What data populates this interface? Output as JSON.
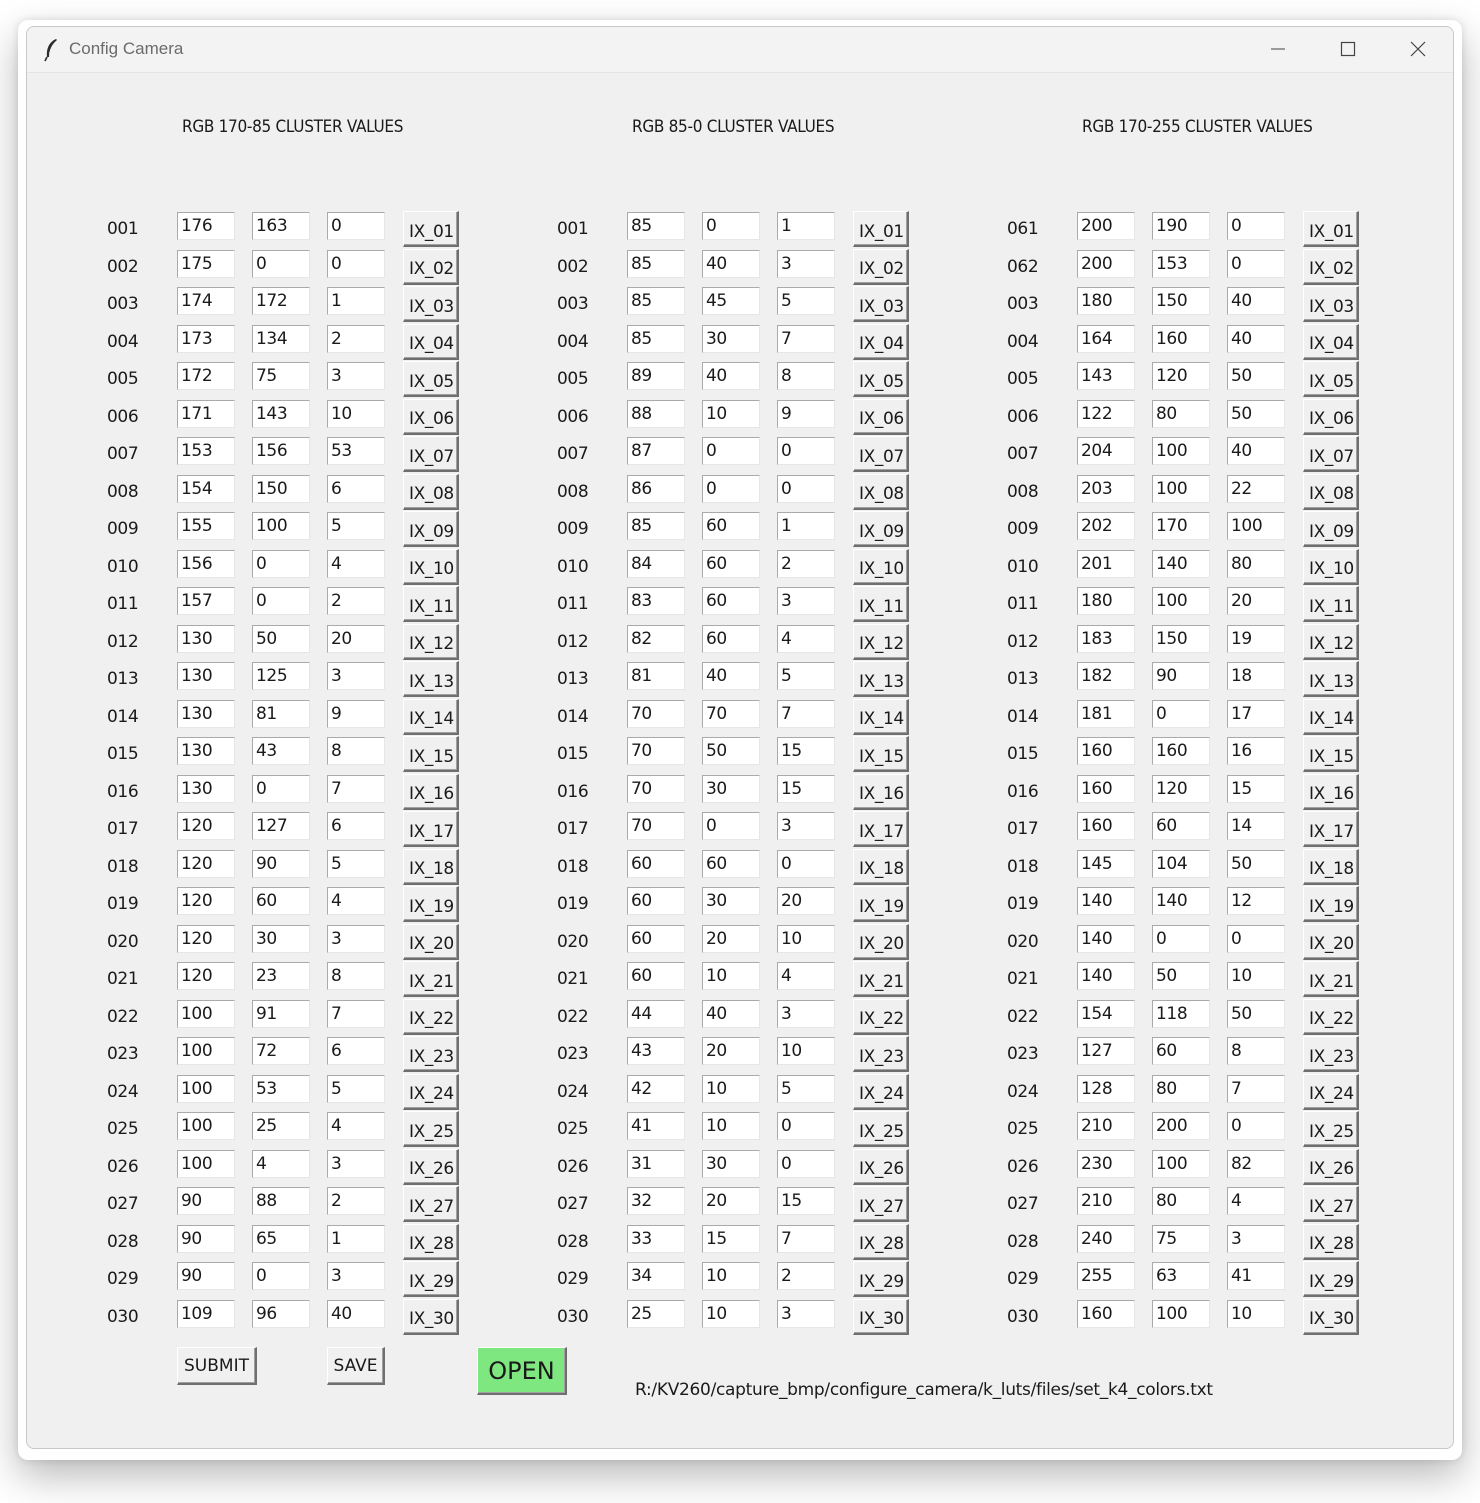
{
  "window": {
    "title": "Config Camera",
    "icon": "feather-icon",
    "controls": [
      "minimize-icon",
      "maximize-icon",
      "close-icon"
    ]
  },
  "columns": [
    {
      "title": "RGB 170-85 CLUSTER VALUES",
      "rows": [
        {
          "label": "001",
          "r": "176",
          "g": "163",
          "b": "0",
          "button": "IX_01"
        },
        {
          "label": "002",
          "r": "175",
          "g": "0",
          "b": "0",
          "button": "IX_02"
        },
        {
          "label": "003",
          "r": "174",
          "g": "172",
          "b": "1",
          "button": "IX_03"
        },
        {
          "label": "004",
          "r": "173",
          "g": "134",
          "b": "2",
          "button": "IX_04"
        },
        {
          "label": "005",
          "r": "172",
          "g": "75",
          "b": "3",
          "button": "IX_05"
        },
        {
          "label": "006",
          "r": "171",
          "g": "143",
          "b": "10",
          "button": "IX_06"
        },
        {
          "label": "007",
          "r": "153",
          "g": "156",
          "b": "53",
          "button": "IX_07"
        },
        {
          "label": "008",
          "r": "154",
          "g": "150",
          "b": "6",
          "button": "IX_08"
        },
        {
          "label": "009",
          "r": "155",
          "g": "100",
          "b": "5",
          "button": "IX_09"
        },
        {
          "label": "010",
          "r": "156",
          "g": "0",
          "b": "4",
          "button": "IX_10"
        },
        {
          "label": "011",
          "r": "157",
          "g": "0",
          "b": "2",
          "button": "IX_11"
        },
        {
          "label": "012",
          "r": "130",
          "g": "50",
          "b": "20",
          "button": "IX_12"
        },
        {
          "label": "013",
          "r": "130",
          "g": "125",
          "b": "3",
          "button": "IX_13"
        },
        {
          "label": "014",
          "r": "130",
          "g": "81",
          "b": "9",
          "button": "IX_14"
        },
        {
          "label": "015",
          "r": "130",
          "g": "43",
          "b": "8",
          "button": "IX_15"
        },
        {
          "label": "016",
          "r": "130",
          "g": "0",
          "b": "7",
          "button": "IX_16"
        },
        {
          "label": "017",
          "r": "120",
          "g": "127",
          "b": "6",
          "button": "IX_17"
        },
        {
          "label": "018",
          "r": "120",
          "g": "90",
          "b": "5",
          "button": "IX_18"
        },
        {
          "label": "019",
          "r": "120",
          "g": "60",
          "b": "4",
          "button": "IX_19"
        },
        {
          "label": "020",
          "r": "120",
          "g": "30",
          "b": "3",
          "button": "IX_20"
        },
        {
          "label": "021",
          "r": "120",
          "g": "23",
          "b": "8",
          "button": "IX_21"
        },
        {
          "label": "022",
          "r": "100",
          "g": "91",
          "b": "7",
          "button": "IX_22"
        },
        {
          "label": "023",
          "r": "100",
          "g": "72",
          "b": "6",
          "button": "IX_23"
        },
        {
          "label": "024",
          "r": "100",
          "g": "53",
          "b": "5",
          "button": "IX_24"
        },
        {
          "label": "025",
          "r": "100",
          "g": "25",
          "b": "4",
          "button": "IX_25"
        },
        {
          "label": "026",
          "r": "100",
          "g": "4",
          "b": "3",
          "button": "IX_26"
        },
        {
          "label": "027",
          "r": "90",
          "g": "88",
          "b": "2",
          "button": "IX_27"
        },
        {
          "label": "028",
          "r": "90",
          "g": "65",
          "b": "1",
          "button": "IX_28"
        },
        {
          "label": "029",
          "r": "90",
          "g": "0",
          "b": "3",
          "button": "IX_29"
        },
        {
          "label": "030",
          "r": "109",
          "g": "96",
          "b": "40",
          "button": "IX_30"
        }
      ]
    },
    {
      "title": "RGB 85-0 CLUSTER VALUES",
      "rows": [
        {
          "label": "001",
          "r": "85",
          "g": "0",
          "b": "1",
          "button": "IX_01"
        },
        {
          "label": "002",
          "r": "85",
          "g": "40",
          "b": "3",
          "button": "IX_02"
        },
        {
          "label": "003",
          "r": "85",
          "g": "45",
          "b": "5",
          "button": "IX_03"
        },
        {
          "label": "004",
          "r": "85",
          "g": "30",
          "b": "7",
          "button": "IX_04"
        },
        {
          "label": "005",
          "r": "89",
          "g": "40",
          "b": "8",
          "button": "IX_05"
        },
        {
          "label": "006",
          "r": "88",
          "g": "10",
          "b": "9",
          "button": "IX_06"
        },
        {
          "label": "007",
          "r": "87",
          "g": "0",
          "b": "0",
          "button": "IX_07"
        },
        {
          "label": "008",
          "r": "86",
          "g": "0",
          "b": "0",
          "button": "IX_08"
        },
        {
          "label": "009",
          "r": "85",
          "g": "60",
          "b": "1",
          "button": "IX_09"
        },
        {
          "label": "010",
          "r": "84",
          "g": "60",
          "b": "2",
          "button": "IX_10"
        },
        {
          "label": "011",
          "r": "83",
          "g": "60",
          "b": "3",
          "button": "IX_11"
        },
        {
          "label": "012",
          "r": "82",
          "g": "60",
          "b": "4",
          "button": "IX_12"
        },
        {
          "label": "013",
          "r": "81",
          "g": "40",
          "b": "5",
          "button": "IX_13"
        },
        {
          "label": "014",
          "r": "70",
          "g": "70",
          "b": "7",
          "button": "IX_14"
        },
        {
          "label": "015",
          "r": "70",
          "g": "50",
          "b": "15",
          "button": "IX_15"
        },
        {
          "label": "016",
          "r": "70",
          "g": "30",
          "b": "15",
          "button": "IX_16"
        },
        {
          "label": "017",
          "r": "70",
          "g": "0",
          "b": "3",
          "button": "IX_17"
        },
        {
          "label": "018",
          "r": "60",
          "g": "60",
          "b": "0",
          "button": "IX_18"
        },
        {
          "label": "019",
          "r": "60",
          "g": "30",
          "b": "20",
          "button": "IX_19"
        },
        {
          "label": "020",
          "r": "60",
          "g": "20",
          "b": "10",
          "button": "IX_20"
        },
        {
          "label": "021",
          "r": "60",
          "g": "10",
          "b": "4",
          "button": "IX_21"
        },
        {
          "label": "022",
          "r": "44",
          "g": "40",
          "b": "3",
          "button": "IX_22"
        },
        {
          "label": "023",
          "r": "43",
          "g": "20",
          "b": "10",
          "button": "IX_23"
        },
        {
          "label": "024",
          "r": "42",
          "g": "10",
          "b": "5",
          "button": "IX_24"
        },
        {
          "label": "025",
          "r": "41",
          "g": "10",
          "b": "0",
          "button": "IX_25"
        },
        {
          "label": "026",
          "r": "31",
          "g": "30",
          "b": "0",
          "button": "IX_26"
        },
        {
          "label": "027",
          "r": "32",
          "g": "20",
          "b": "15",
          "button": "IX_27"
        },
        {
          "label": "028",
          "r": "33",
          "g": "15",
          "b": "7",
          "button": "IX_28"
        },
        {
          "label": "029",
          "r": "34",
          "g": "10",
          "b": "2",
          "button": "IX_29"
        },
        {
          "label": "030",
          "r": "25",
          "g": "10",
          "b": "3",
          "button": "IX_30"
        }
      ]
    },
    {
      "title": "RGB 170-255 CLUSTER VALUES",
      "rows": [
        {
          "label": "061",
          "r": "200",
          "g": "190",
          "b": "0",
          "button": "IX_01"
        },
        {
          "label": "062",
          "r": "200",
          "g": "153",
          "b": "0",
          "button": "IX_02"
        },
        {
          "label": "003",
          "r": "180",
          "g": "150",
          "b": "40",
          "button": "IX_03"
        },
        {
          "label": "004",
          "r": "164",
          "g": "160",
          "b": "40",
          "button": "IX_04"
        },
        {
          "label": "005",
          "r": "143",
          "g": "120",
          "b": "50",
          "button": "IX_05"
        },
        {
          "label": "006",
          "r": "122",
          "g": "80",
          "b": "50",
          "button": "IX_06"
        },
        {
          "label": "007",
          "r": "204",
          "g": "100",
          "b": "40",
          "button": "IX_07"
        },
        {
          "label": "008",
          "r": "203",
          "g": "100",
          "b": "22",
          "button": "IX_08"
        },
        {
          "label": "009",
          "r": "202",
          "g": "170",
          "b": "100",
          "button": "IX_09"
        },
        {
          "label": "010",
          "r": "201",
          "g": "140",
          "b": "80",
          "button": "IX_10"
        },
        {
          "label": "011",
          "r": "180",
          "g": "100",
          "b": "20",
          "button": "IX_11"
        },
        {
          "label": "012",
          "r": "183",
          "g": "150",
          "b": "19",
          "button": "IX_12"
        },
        {
          "label": "013",
          "r": "182",
          "g": "90",
          "b": "18",
          "button": "IX_13"
        },
        {
          "label": "014",
          "r": "181",
          "g": "0",
          "b": "17",
          "button": "IX_14"
        },
        {
          "label": "015",
          "r": "160",
          "g": "160",
          "b": "16",
          "button": "IX_15"
        },
        {
          "label": "016",
          "r": "160",
          "g": "120",
          "b": "15",
          "button": "IX_16"
        },
        {
          "label": "017",
          "r": "160",
          "g": "60",
          "b": "14",
          "button": "IX_17"
        },
        {
          "label": "018",
          "r": "145",
          "g": "104",
          "b": "50",
          "button": "IX_18"
        },
        {
          "label": "019",
          "r": "140",
          "g": "140",
          "b": "12",
          "button": "IX_19"
        },
        {
          "label": "020",
          "r": "140",
          "g": "0",
          "b": "0",
          "button": "IX_20"
        },
        {
          "label": "021",
          "r": "140",
          "g": "50",
          "b": "10",
          "button": "IX_21"
        },
        {
          "label": "022",
          "r": "154",
          "g": "118",
          "b": "50",
          "button": "IX_22"
        },
        {
          "label": "023",
          "r": "127",
          "g": "60",
          "b": "8",
          "button": "IX_23"
        },
        {
          "label": "024",
          "r": "128",
          "g": "80",
          "b": "7",
          "button": "IX_24"
        },
        {
          "label": "025",
          "r": "210",
          "g": "200",
          "b": "0",
          "button": "IX_25"
        },
        {
          "label": "026",
          "r": "230",
          "g": "100",
          "b": "82",
          "button": "IX_26"
        },
        {
          "label": "027",
          "r": "210",
          "g": "80",
          "b": "4",
          "button": "IX_27"
        },
        {
          "label": "028",
          "r": "240",
          "g": "75",
          "b": "3",
          "button": "IX_28"
        },
        {
          "label": "029",
          "r": "255",
          "g": "63",
          "b": "41",
          "button": "IX_29"
        },
        {
          "label": "030",
          "r": "160",
          "g": "100",
          "b": "10",
          "button": "IX_30"
        }
      ]
    }
  ],
  "actions": {
    "submit_label": "SUBMIT",
    "save_label": "SAVE",
    "open_label": "OPEN",
    "open_color": "#7fe77f",
    "file_path": "R:/KV260/capture_bmp/configure_camera/k_luts/files/set_k4_colors.txt"
  }
}
